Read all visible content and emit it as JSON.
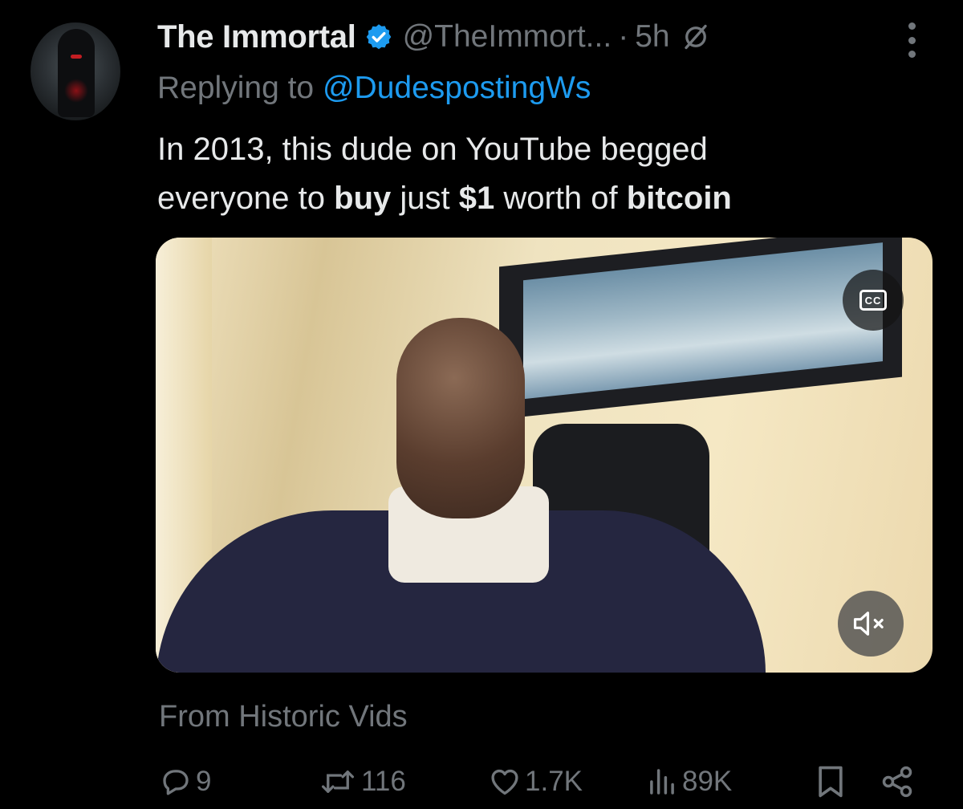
{
  "author": {
    "name": "The Immortal",
    "handle": "@TheImmort...",
    "separator": "·",
    "time": "5h"
  },
  "reply": {
    "prefix": "Replying to",
    "mention": "@DudespostingWs"
  },
  "tweet": {
    "line1": "In 2013, this dude on YouTube begged",
    "line2_a": "everyone to ",
    "line2_b": "buy",
    "line2_c": " just ",
    "line2_d": "$1",
    "line2_e": " worth of ",
    "line2_f": "bitcoin"
  },
  "media": {
    "cc_label": "CC"
  },
  "source_label": "From Historic Vids",
  "metrics": {
    "replies": "9",
    "reposts": "116",
    "likes": "1.7K",
    "views": "89K"
  },
  "colors": {
    "background": "#000000",
    "text": "#e7e9ea",
    "muted": "#71767b",
    "accent": "#1d9bf0"
  },
  "icons": [
    "verified-badge-icon",
    "no-lock-icon",
    "more-icon",
    "cc-icon",
    "mute-icon",
    "reply-icon",
    "repost-icon",
    "like-icon",
    "views-icon",
    "bookmark-icon",
    "share-icon"
  ]
}
